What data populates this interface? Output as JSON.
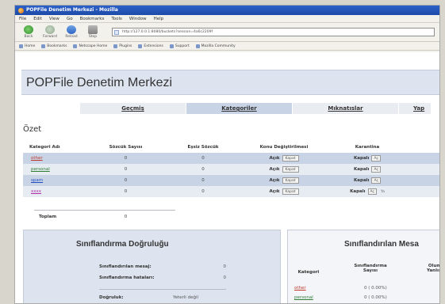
{
  "browser": {
    "title": "POPFile Denetim Merkezi - Mozilla",
    "menu": [
      "File",
      "Edit",
      "View",
      "Go",
      "Bookmarks",
      "Tools",
      "Window",
      "Help"
    ],
    "toolbar": {
      "back": "Back",
      "forward": "Forward",
      "reload": "Reload",
      "stop": "Stop"
    },
    "url": "http://127.0.0.1:8080/buckets?session=4a6c2209f",
    "bookmarks": [
      "Home",
      "Bookmarks",
      "Netscape Home",
      "Plugins",
      "Extensions",
      "Support",
      "Mozilla Community"
    ]
  },
  "page": {
    "title": "POPFile Denetim Merkezi",
    "tabs": [
      "Geçmiş",
      "Kategoriler",
      "Mıknatıslar",
      "Yap"
    ],
    "active_tab": 1,
    "summary_title": "Özet"
  },
  "summary": {
    "headers": [
      "Kategori Adı",
      "Sözcük Sayısı",
      "Eşsiz Sözcük",
      "Konu Değiştirilmesi",
      "Karantina"
    ],
    "rows": [
      {
        "name": "other",
        "words": "0",
        "unique": "0",
        "subject": "Açık",
        "subject_btn": "Kapat",
        "quarantine": "Kapalı",
        "quarantine_btn": "Aç",
        "extra": ""
      },
      {
        "name": "personal",
        "words": "0",
        "unique": "0",
        "subject": "Açık",
        "subject_btn": "Kapat",
        "quarantine": "Kapalı",
        "quarantine_btn": "Aç",
        "extra": ""
      },
      {
        "name": "spam",
        "words": "0",
        "unique": "0",
        "subject": "Açık",
        "subject_btn": "Kapat",
        "quarantine": "Kapalı",
        "quarantine_btn": "Aç",
        "extra": ""
      },
      {
        "name": "xxxx",
        "words": "0",
        "unique": "0",
        "subject": "Açık",
        "subject_btn": "Kapat",
        "quarantine": "Kapalı",
        "quarantine_btn": "Aç",
        "extra": "Ya"
      }
    ],
    "total_label": "Toplam",
    "total_words": "0"
  },
  "accuracy": {
    "title": "Sınıflandırma Doğruluğu",
    "classified_label": "Sınıflandırılan mesaj:",
    "classified_value": "0",
    "errors_label": "Sınıflandırma hataları:",
    "errors_value": "0",
    "accuracy_label": "Doğruluk:",
    "accuracy_value": "Yeterli değil"
  },
  "classified": {
    "title": "Sınıflandırılan Mesa",
    "headers": [
      "Kategori",
      "Sınıflandırma Sayısı",
      "Olum Yanlışl"
    ],
    "rows": [
      {
        "name": "other",
        "count": "0 ( 0.00%)"
      },
      {
        "name": "personal",
        "count": "0 ( 0.00%)"
      }
    ]
  }
}
